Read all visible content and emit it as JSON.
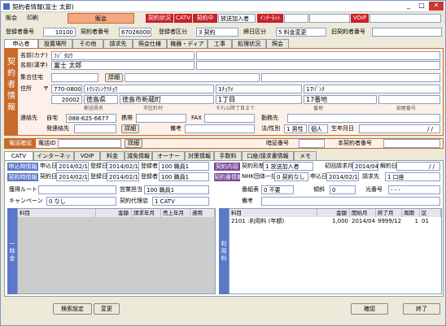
{
  "window": {
    "title": "契約者情報(富士 太郎)"
  },
  "menu": [
    "販会",
    "印刷"
  ],
  "top": {
    "title_band": "販会",
    "status": [
      {
        "label": "契約状況",
        "style": "red"
      },
      {
        "label": "CATV",
        "style": "red"
      },
      {
        "label": "契約中",
        "style": "red"
      },
      {
        "label": "放送加入者",
        "style": "plain"
      },
      {
        "label": "ｲﾝﾀｰﾈｯﾄ",
        "style": "red"
      },
      {
        "label": "",
        "style": "plain"
      },
      {
        "label": "",
        "style": "plain"
      },
      {
        "label": "VOIP",
        "style": "red"
      },
      {
        "label": "",
        "style": "plain"
      }
    ]
  },
  "ids": {
    "seq_label": "登録者番号",
    "seq_value": "10100",
    "contract_label": "契約者番号",
    "contract_value": "67026000",
    "reg_label": "登録者区分",
    "reg_value": "3 契約",
    "tax_label": "締日区分",
    "tax_value": "5 料金変更",
    "old_label": "旧契約者番号",
    "old_value": ""
  },
  "tabs": [
    "申込者",
    "設置場所",
    "その他",
    "請求先",
    "照会仕様",
    "機器・ディア",
    "工事",
    "処理状況",
    "照会"
  ],
  "contractor": {
    "side": "契約者情報",
    "kana_label": "名前(カナ)",
    "kana_value": "ﾌｼﾞ ﾀﾛｳ",
    "name_label": "名前(漢字)",
    "name_value": "富士 太郎",
    "group_label": "集合住宅",
    "detail_btn": "詳細",
    "addr_label": "住所",
    "zip_mark": "〒",
    "zip_value": "770-0800",
    "addr_kana": [
      "ﾄｸｼﾏｼﾝｸﾗﾁｮｳ",
      "1ﾁｮｳﾒ",
      "17ﾊﾞﾝﾁ"
    ],
    "pref_code": "20002",
    "pref": "徳島県",
    "city": "徳島市新蔵町",
    "chome": "1丁目",
    "banchi": "17番地",
    "sub_labels": [
      "郵送県名",
      "市区町村",
      "それ以降丁目まで",
      "番地",
      "部屋番号"
    ],
    "contact_label": "連絡先",
    "home_label": "自宅",
    "home_value": "088-625-6677",
    "mobile_label": "携帯",
    "fax_label": "FAX",
    "delivery_label": "発連絡先",
    "detail_btn2": "詳細",
    "note_label": "備考",
    "work_label": "勤務先",
    "sex_label": "法/性別",
    "sex_value": "1 男性",
    "corp_value": "個人",
    "birth_label": "生年月日",
    "birth_value": "/ /"
  },
  "phone_bar": {
    "tab": "電話確認",
    "id_label": "電話ID",
    "detail_btn": "詳細",
    "pw_label": "暗証番号",
    "main_label": "本契約者番号"
  },
  "service_tabs": [
    "CATV",
    "インターネット",
    "VOIP",
    "料金",
    "減免情報",
    "オーナー",
    "対策情報",
    "手数料",
    "口座/請求書情報",
    "メモ"
  ],
  "catv": {
    "apply_tag": "申込時情報",
    "apply_day_label": "申込日",
    "apply_day": "2014/02/14",
    "reg_day_label": "登録日",
    "reg_day": "2014/02/14",
    "registrant_label": "登録者",
    "registrant": "100 職員1",
    "contract_tag": "契約時情報",
    "contract_day_label": "契約日",
    "contract_day": "2014/02/14",
    "reg_day2": "2014/02/14",
    "registrant2": "100 職員1",
    "route_label": "獲得ルート",
    "sales_label": "営業担当",
    "sales_value": "100 職員1",
    "campaign_label": "キャンペーン",
    "campaign_value": "0 なし",
    "agent_label": "契約代理店",
    "agent_value": "1 CATV",
    "right": {
      "content_tag": "契約内容",
      "form_label": "契約形態",
      "form_value": "1 放送加入者",
      "first_label": "初回請求月",
      "first_value": "2014/04",
      "cancel_label": "解約日",
      "cancel_value": "/ /",
      "inv_tag": "契約書情報",
      "vat_label": "NHK団体一括",
      "vat_value": "0 契約なし",
      "apply_label": "申込日",
      "apply_value": "2014/02/14",
      "bill_label": "請求先",
      "bill_value": "1 口座",
      "meter_label": "番組表",
      "meter_value": "0 不要",
      "discount_label": "傾斜",
      "discount_value": "0",
      "opt_label": "光番号",
      "opt_value": "- - -",
      "note_label": "備考"
    }
  },
  "left_table": {
    "side": "一時金",
    "headers": [
      "料目",
      "金額",
      "請求年月",
      "売上年月",
      "適用"
    ],
    "rows": []
  },
  "right_table": {
    "side": "利用料",
    "headers": [
      "料目",
      "金額",
      "開始月",
      "終了月",
      "周期",
      "区"
    ],
    "rows": [
      [
        "2101 :利用料 (年額)",
        "1,000",
        "2014/04",
        "9999/12",
        "1",
        "01"
      ]
    ]
  },
  "buttons": {
    "settings": "検索設定",
    "change": "変更",
    "confirm": "確認",
    "close": "終了"
  },
  "colors": {
    "accent": "#c86a2c",
    "status_red": "#c8202c",
    "side_blue": "#5c78c8",
    "side_purple": "#7a4a9a"
  }
}
